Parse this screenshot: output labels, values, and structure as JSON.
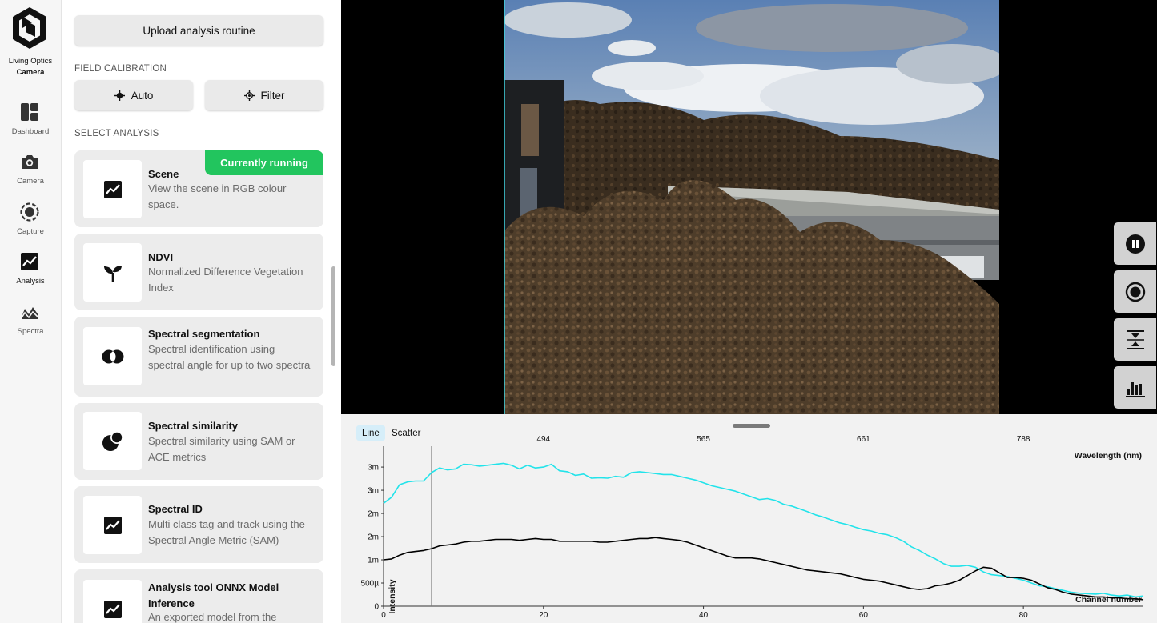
{
  "brand": {
    "line1": "Living Optics",
    "line2": "Camera"
  },
  "nav": [
    {
      "label": "Dashboard",
      "icon": "dashboard-icon"
    },
    {
      "label": "Camera",
      "icon": "camera-icon"
    },
    {
      "label": "Capture",
      "icon": "capture-icon"
    },
    {
      "label": "Analysis",
      "icon": "analysis-icon",
      "active": true
    },
    {
      "label": "Spectra",
      "icon": "spectra-icon"
    }
  ],
  "panel": {
    "upload_label": "Upload analysis routine",
    "field_calibration_label": "FIELD CALIBRATION",
    "auto_label": "Auto",
    "filter_label": "Filter",
    "select_analysis_label": "SELECT ANALYSIS",
    "running_label": "Currently running",
    "analyses": [
      {
        "title": "Scene",
        "desc": "View the scene in RGB colour space.",
        "icon": "line-chart-icon",
        "running": true
      },
      {
        "title": "NDVI",
        "desc": "Normalized Difference Vegetation Index",
        "icon": "sprout-icon"
      },
      {
        "title": "Spectral segmentation",
        "desc": "Spectral identification using spectral angle for up to two spectra",
        "icon": "overlap-circles-icon"
      },
      {
        "title": "Spectral similarity",
        "desc": "Spectral similarity using SAM or ACE metrics",
        "icon": "two-circles-icon"
      },
      {
        "title": "Spectral ID",
        "desc": "Multi class tag and track using the Spectral Angle Metric (SAM)",
        "icon": "line-chart-icon"
      },
      {
        "title": "Analysis tool ONNX Model Inference",
        "desc": "An exported model from the",
        "icon": "line-chart-icon"
      }
    ]
  },
  "viewer": {
    "controls": [
      "pause-icon",
      "record-icon",
      "compress-icon",
      "histogram-icon"
    ]
  },
  "chart_tabs": {
    "line": "Line",
    "scatter": "Scatter"
  },
  "chart_data": {
    "type": "line",
    "xlabel": "Channel number",
    "ylabel": "Intensity",
    "x2label": "Wavelength (nm)",
    "xlim": [
      0,
      95
    ],
    "ylim": [
      0,
      3.45
    ],
    "x_ticks": [
      0,
      20,
      40,
      60,
      80
    ],
    "y_ticks": [
      {
        "label": "0",
        "value": 0
      },
      {
        "label": "500µ",
        "value": 0.5
      },
      {
        "label": "1m",
        "value": 1
      },
      {
        "label": "2m",
        "value": 1.5
      },
      {
        "label": "2m",
        "value": 2
      },
      {
        "label": "3m",
        "value": 2.5
      },
      {
        "label": "3m",
        "value": 3
      }
    ],
    "wavelength_ticks": [
      {
        "label": "494",
        "channel": 20
      },
      {
        "label": "565",
        "channel": 40
      },
      {
        "label": "661",
        "channel": 60
      },
      {
        "label": "788",
        "channel": 80
      }
    ],
    "cursor_channel": 6,
    "series": [
      {
        "color": "#22e3ea",
        "x": [
          0,
          1,
          2,
          3,
          4,
          5,
          6,
          7,
          8,
          9,
          10,
          11,
          12,
          13,
          14,
          15,
          16,
          17,
          18,
          19,
          20,
          21,
          22,
          23,
          24,
          25,
          26,
          27,
          28,
          29,
          30,
          31,
          32,
          33,
          34,
          35,
          36,
          37,
          38,
          39,
          40,
          41,
          42,
          43,
          44,
          45,
          46,
          47,
          48,
          49,
          50,
          51,
          52,
          53,
          54,
          55,
          56,
          57,
          58,
          59,
          60,
          61,
          62,
          63,
          64,
          65,
          66,
          67,
          68,
          69,
          70,
          71,
          72,
          73,
          74,
          75,
          76,
          77,
          78,
          79,
          80,
          81,
          82,
          83,
          84,
          85,
          86,
          87,
          88,
          89,
          90,
          91,
          92,
          93,
          94,
          95
        ],
        "values": [
          2.22,
          2.35,
          2.62,
          2.68,
          2.7,
          2.7,
          2.88,
          2.98,
          2.94,
          2.96,
          3.06,
          3.05,
          3.02,
          3.04,
          3.06,
          3.08,
          3.04,
          2.96,
          3.04,
          2.98,
          3.0,
          3.06,
          2.92,
          2.9,
          2.82,
          2.85,
          2.76,
          2.77,
          2.76,
          2.8,
          2.78,
          2.88,
          2.9,
          2.88,
          2.86,
          2.84,
          2.84,
          2.8,
          2.76,
          2.72,
          2.66,
          2.6,
          2.56,
          2.52,
          2.48,
          2.42,
          2.36,
          2.3,
          2.32,
          2.28,
          2.2,
          2.16,
          2.1,
          2.04,
          1.97,
          1.92,
          1.86,
          1.8,
          1.76,
          1.7,
          1.65,
          1.62,
          1.57,
          1.54,
          1.48,
          1.4,
          1.28,
          1.2,
          1.1,
          1.02,
          0.92,
          0.86,
          0.86,
          0.88,
          0.84,
          0.74,
          0.68,
          0.66,
          0.64,
          0.6,
          0.56,
          0.5,
          0.44,
          0.42,
          0.38,
          0.34,
          0.3,
          0.28,
          0.27,
          0.26,
          0.28,
          0.24,
          0.22,
          0.24,
          0.2,
          0.22
        ]
      },
      {
        "color": "#000000",
        "x": [
          0,
          1,
          2,
          3,
          4,
          5,
          6,
          7,
          8,
          9,
          10,
          11,
          12,
          13,
          14,
          15,
          16,
          17,
          18,
          19,
          20,
          21,
          22,
          23,
          24,
          25,
          26,
          27,
          28,
          29,
          30,
          31,
          32,
          33,
          34,
          35,
          36,
          37,
          38,
          39,
          40,
          41,
          42,
          43,
          44,
          45,
          46,
          47,
          48,
          49,
          50,
          51,
          52,
          53,
          54,
          55,
          56,
          57,
          58,
          59,
          60,
          61,
          62,
          63,
          64,
          65,
          66,
          67,
          68,
          69,
          70,
          71,
          72,
          73,
          74,
          75,
          76,
          77,
          78,
          79,
          80,
          81,
          82,
          83,
          84,
          85,
          86,
          87,
          88,
          89,
          90,
          91,
          92,
          93,
          94,
          95
        ],
        "values": [
          1.0,
          1.02,
          1.1,
          1.16,
          1.18,
          1.2,
          1.24,
          1.3,
          1.32,
          1.34,
          1.38,
          1.4,
          1.4,
          1.42,
          1.44,
          1.44,
          1.44,
          1.42,
          1.44,
          1.46,
          1.44,
          1.44,
          1.4,
          1.4,
          1.4,
          1.4,
          1.4,
          1.38,
          1.38,
          1.4,
          1.42,
          1.44,
          1.46,
          1.46,
          1.48,
          1.46,
          1.44,
          1.42,
          1.38,
          1.32,
          1.26,
          1.2,
          1.14,
          1.08,
          1.04,
          1.04,
          1.04,
          1.02,
          0.98,
          0.94,
          0.9,
          0.86,
          0.82,
          0.78,
          0.76,
          0.74,
          0.72,
          0.7,
          0.66,
          0.62,
          0.58,
          0.56,
          0.54,
          0.5,
          0.46,
          0.42,
          0.38,
          0.36,
          0.38,
          0.44,
          0.46,
          0.5,
          0.56,
          0.66,
          0.76,
          0.84,
          0.82,
          0.72,
          0.62,
          0.62,
          0.6,
          0.56,
          0.48,
          0.4,
          0.36,
          0.3,
          0.26,
          0.24,
          0.22,
          0.2,
          0.2,
          0.18,
          0.18,
          0.16,
          0.16,
          0.14
        ]
      }
    ]
  }
}
